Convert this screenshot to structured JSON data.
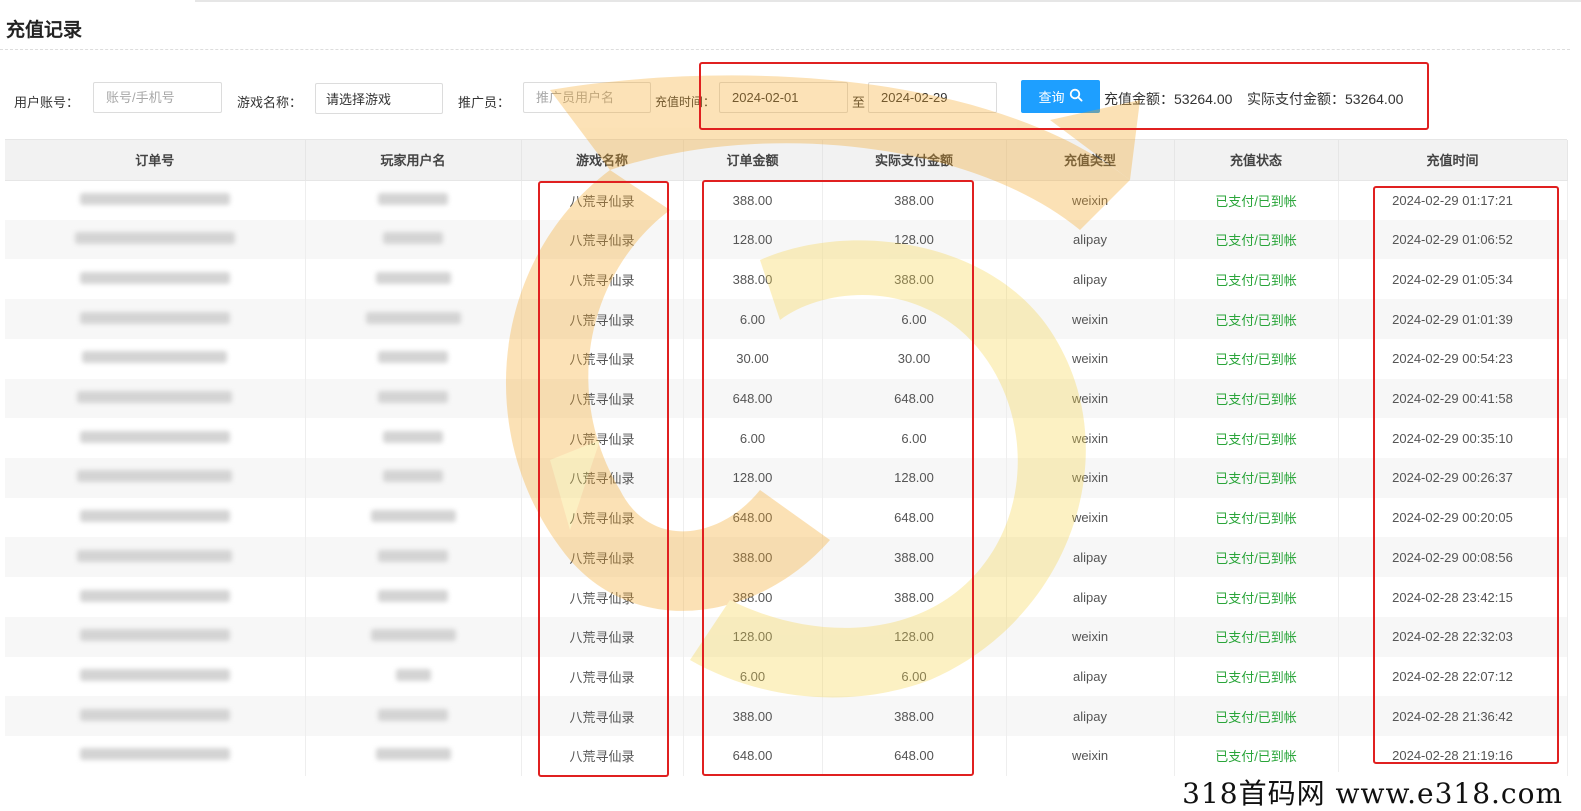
{
  "page": {
    "title": "充值记录"
  },
  "filters": {
    "account_label": "用户账号：",
    "account_placeholder": "账号/手机号",
    "game_label": "游戏名称：",
    "game_selected": "请选择游戏",
    "promoter_label": "推广员：",
    "promoter_placeholder": "推广员用户名",
    "time_label": "充值时间：",
    "start_date": "2024-02-01",
    "to_label": "至",
    "end_date": "2024-02-29",
    "query_label": "查询",
    "recharge_total_label": "充值金额：53264.00",
    "paid_total_label": "实际支付金额：53264.00"
  },
  "table": {
    "columns": [
      "订单号",
      "玩家用户名",
      "游戏名称",
      "订单金额",
      "实际支付金额",
      "充值类型",
      "充值状态",
      "充值时间"
    ],
    "rows": [
      {
        "game": "八荒寻仙录",
        "amount": "388.00",
        "paid": "388.00",
        "type": "weixin",
        "status": "已支付/已到帐",
        "time": "2024-02-29 01:17:21"
      },
      {
        "game": "八荒寻仙录",
        "amount": "128.00",
        "paid": "128.00",
        "type": "alipay",
        "status": "已支付/已到帐",
        "time": "2024-02-29 01:06:52"
      },
      {
        "game": "八荒寻仙录",
        "amount": "388.00",
        "paid": "388.00",
        "type": "alipay",
        "status": "已支付/已到帐",
        "time": "2024-02-29 01:05:34"
      },
      {
        "game": "八荒寻仙录",
        "amount": "6.00",
        "paid": "6.00",
        "type": "weixin",
        "status": "已支付/已到帐",
        "time": "2024-02-29 01:01:39"
      },
      {
        "game": "八荒寻仙录",
        "amount": "30.00",
        "paid": "30.00",
        "type": "weixin",
        "status": "已支付/已到帐",
        "time": "2024-02-29 00:54:23"
      },
      {
        "game": "八荒寻仙录",
        "amount": "648.00",
        "paid": "648.00",
        "type": "weixin",
        "status": "已支付/已到帐",
        "time": "2024-02-29 00:41:58"
      },
      {
        "game": "八荒寻仙录",
        "amount": "6.00",
        "paid": "6.00",
        "type": "weixin",
        "status": "已支付/已到帐",
        "time": "2024-02-29 00:35:10"
      },
      {
        "game": "八荒寻仙录",
        "amount": "128.00",
        "paid": "128.00",
        "type": "weixin",
        "status": "已支付/已到帐",
        "time": "2024-02-29 00:26:37"
      },
      {
        "game": "八荒寻仙录",
        "amount": "648.00",
        "paid": "648.00",
        "type": "weixin",
        "status": "已支付/已到帐",
        "time": "2024-02-29 00:20:05"
      },
      {
        "game": "八荒寻仙录",
        "amount": "388.00",
        "paid": "388.00",
        "type": "alipay",
        "status": "已支付/已到帐",
        "time": "2024-02-29 00:08:56"
      },
      {
        "game": "八荒寻仙录",
        "amount": "388.00",
        "paid": "388.00",
        "type": "alipay",
        "status": "已支付/已到帐",
        "time": "2024-02-28 23:42:15"
      },
      {
        "game": "八荒寻仙录",
        "amount": "128.00",
        "paid": "128.00",
        "type": "weixin",
        "status": "已支付/已到帐",
        "time": "2024-02-28 22:32:03"
      },
      {
        "game": "八荒寻仙录",
        "amount": "6.00",
        "paid": "6.00",
        "type": "alipay",
        "status": "已支付/已到帐",
        "time": "2024-02-28 22:07:12"
      },
      {
        "game": "八荒寻仙录",
        "amount": "388.00",
        "paid": "388.00",
        "type": "alipay",
        "status": "已支付/已到帐",
        "time": "2024-02-28 21:36:42"
      },
      {
        "game": "八荒寻仙录",
        "amount": "648.00",
        "paid": "648.00",
        "type": "weixin",
        "status": "已支付/已到帐",
        "time": "2024-02-28 21:19:16"
      }
    ]
  },
  "watermark": {
    "site_text": "318首码网  www.e318.com"
  },
  "colors": {
    "accent": "#1e9fff",
    "status_green": "#2aa53a",
    "annotation_red": "#e02020",
    "watermark_orange": "#f5a623",
    "watermark_yellow": "#f7d44a"
  }
}
